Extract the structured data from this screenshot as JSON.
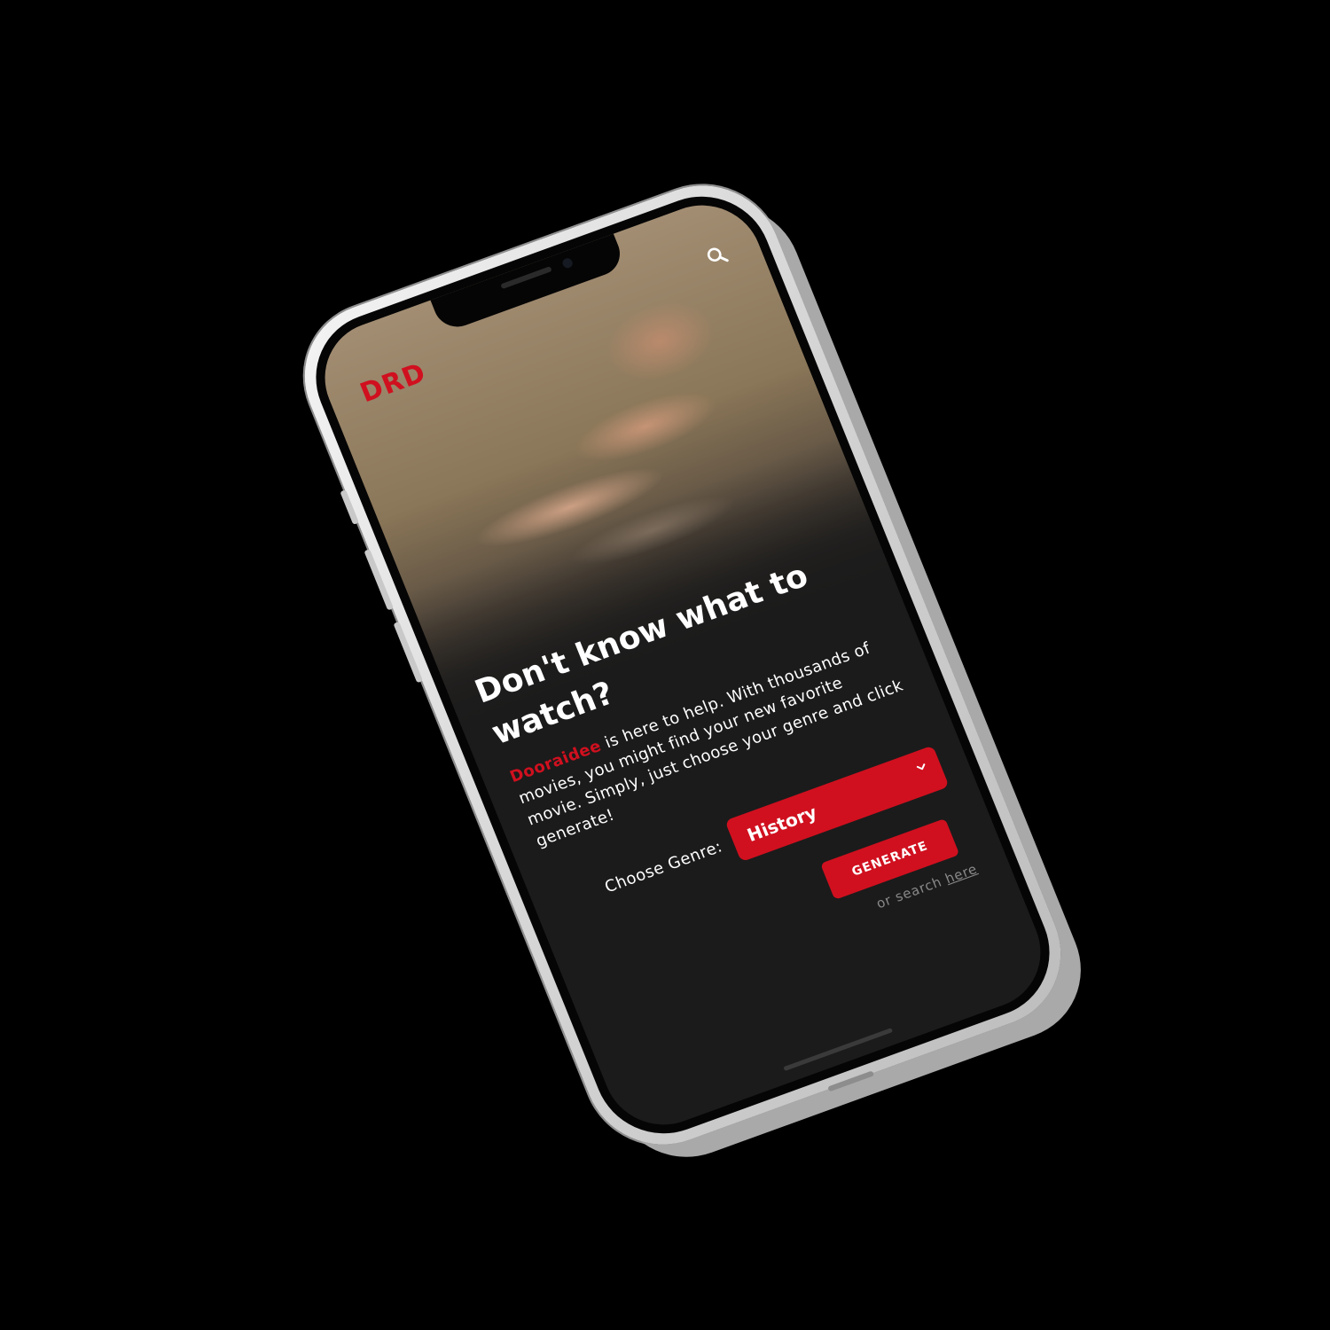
{
  "app": {
    "logo": "DRD"
  },
  "header": {
    "search_icon": "search-icon"
  },
  "hero": {
    "headline": "Don't know what to watch?"
  },
  "intro": {
    "brand": "Dooraidee",
    "text": " is here to help. With thousands of movies, you might find your new favorite movie. Simply, just choose your genre and click generate!"
  },
  "genre": {
    "label": "Choose Genre:",
    "selected": "History",
    "chevron_icon": "chevron-down-icon"
  },
  "actions": {
    "generate_label": "GENERATE",
    "search_prefix": "or search ",
    "search_link": "here"
  },
  "colors": {
    "accent": "#d0101f",
    "text": "#ffffff",
    "muted": "#8a8a8a",
    "background": "#1b1b1b"
  }
}
